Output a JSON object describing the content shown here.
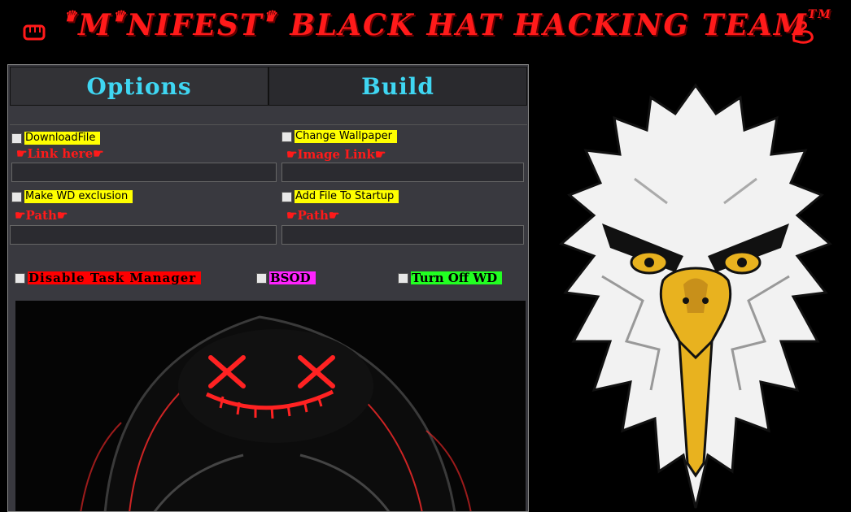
{
  "banner": {
    "title_parts": [
      "M",
      "NIFEST",
      " BLACK HAT HACKING TEAM"
    ],
    "tm": "TM"
  },
  "tabs": [
    {
      "label": "Options"
    },
    {
      "label": "Build"
    }
  ],
  "options": {
    "download_file": {
      "label": "DownloadFile",
      "hint": "Link here",
      "value": "",
      "checked": false
    },
    "change_wallpaper": {
      "label": "Change Wallpaper",
      "hint": "Image Link",
      "value": "",
      "checked": false
    },
    "wd_exclusion": {
      "label": "Make WD exclusion",
      "hint": "Path",
      "value": "",
      "checked": false
    },
    "startup": {
      "label": "Add File To Startup",
      "hint": "Path",
      "value": "",
      "checked": false
    },
    "disable_task_manager": {
      "label": "Disable Task Manager",
      "checked": false
    },
    "bsod": {
      "label": "BSOD",
      "checked": false
    },
    "turn_off_wd": {
      "label": "Turn Off WD",
      "checked": false
    }
  },
  "colors": {
    "accent_red": "#ff1a1a",
    "tab_text": "#3fd6f2",
    "yellow_label": "#ffff00",
    "magenta_label": "#ff22ff",
    "green_label": "#22ff22"
  },
  "icons": [
    "fist-icon",
    "crown-icon",
    "muscle-icon",
    "finger-point-icon"
  ]
}
